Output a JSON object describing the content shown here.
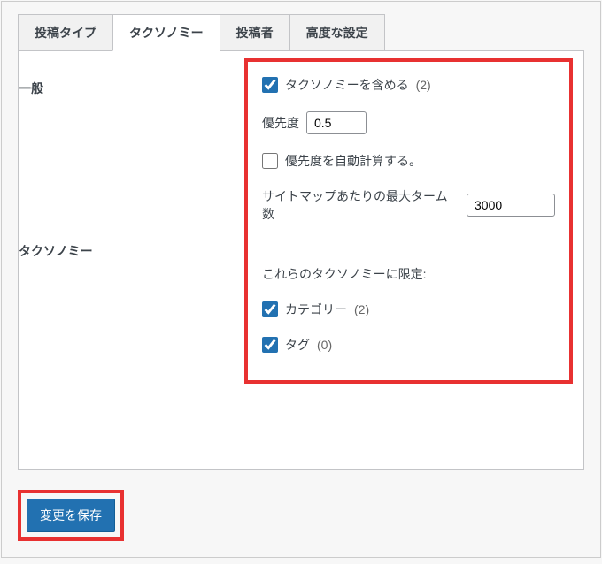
{
  "tabs": {
    "post_types": "投稿タイプ",
    "taxonomies": "タクソノミー",
    "authors": "投稿者",
    "advanced": "高度な設定"
  },
  "sections": {
    "general": "一般",
    "taxonomy": "タクソノミー"
  },
  "general": {
    "include_taxonomies_label": "タクソノミーを含める",
    "include_count": "(2)",
    "priority_label": "優先度",
    "priority_value": "0.5",
    "auto_priority_label": "優先度を自動計算する。",
    "max_terms_label": "サイトマップあたりの最大ターム数",
    "max_terms_value": "3000"
  },
  "taxonomy": {
    "limit_label": "これらのタクソノミーに限定:",
    "categories_label": "カテゴリー",
    "categories_count": "(2)",
    "tags_label": "タグ",
    "tags_count": "(0)"
  },
  "save": {
    "label": "変更を保存"
  }
}
